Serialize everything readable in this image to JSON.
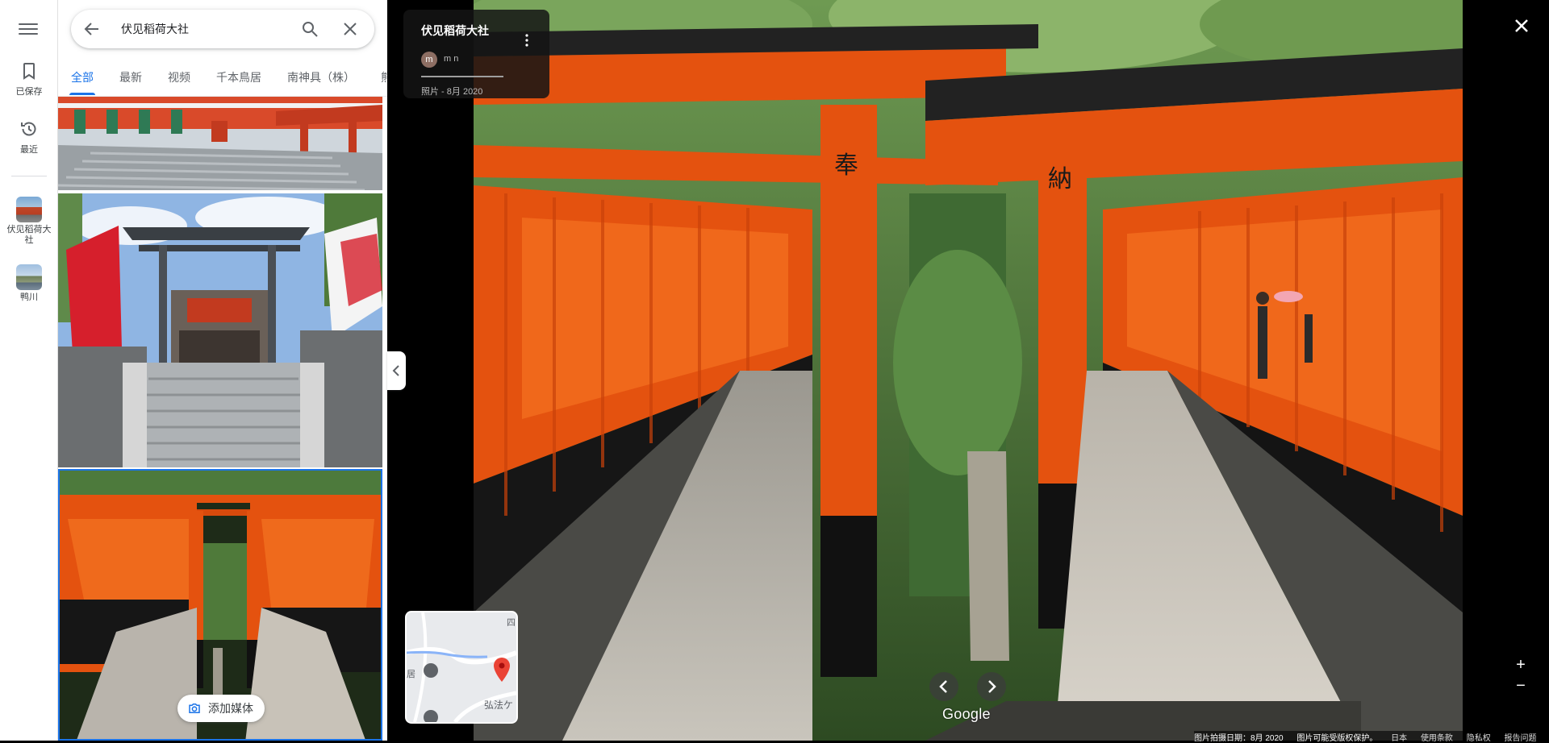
{
  "rail": {
    "saved_label": "已保存",
    "recent_label": "最近",
    "pinned": [
      {
        "label": "伏见稻荷大社"
      },
      {
        "label": "鸭川"
      }
    ]
  },
  "search": {
    "query": "伏见稻荷大社"
  },
  "tabs": [
    "全部",
    "最新",
    "视频",
    "千本鳥居",
    "南神具（株）",
    "熊"
  ],
  "add_media_label": "添加媒体",
  "viewer": {
    "title": "伏见稻荷大社",
    "avatar_initial": "m",
    "user_name": "m n",
    "meta": "照片 - 8月 2020",
    "google_label": "Google",
    "zoom_in": "+",
    "zoom_out": "−"
  },
  "minimap": {
    "label_top": "四",
    "label_bottom": "弘法ケ",
    "label_left": "居"
  },
  "footer": {
    "date": "图片拍摄日期：8月 2020",
    "copyright": "图片可能受版权保护。",
    "region": "日本",
    "terms": "使用条款",
    "privacy": "隐私权",
    "report": "报告问题"
  },
  "colors": {
    "accent": "#1a73e8",
    "torii": "#e4520f"
  }
}
